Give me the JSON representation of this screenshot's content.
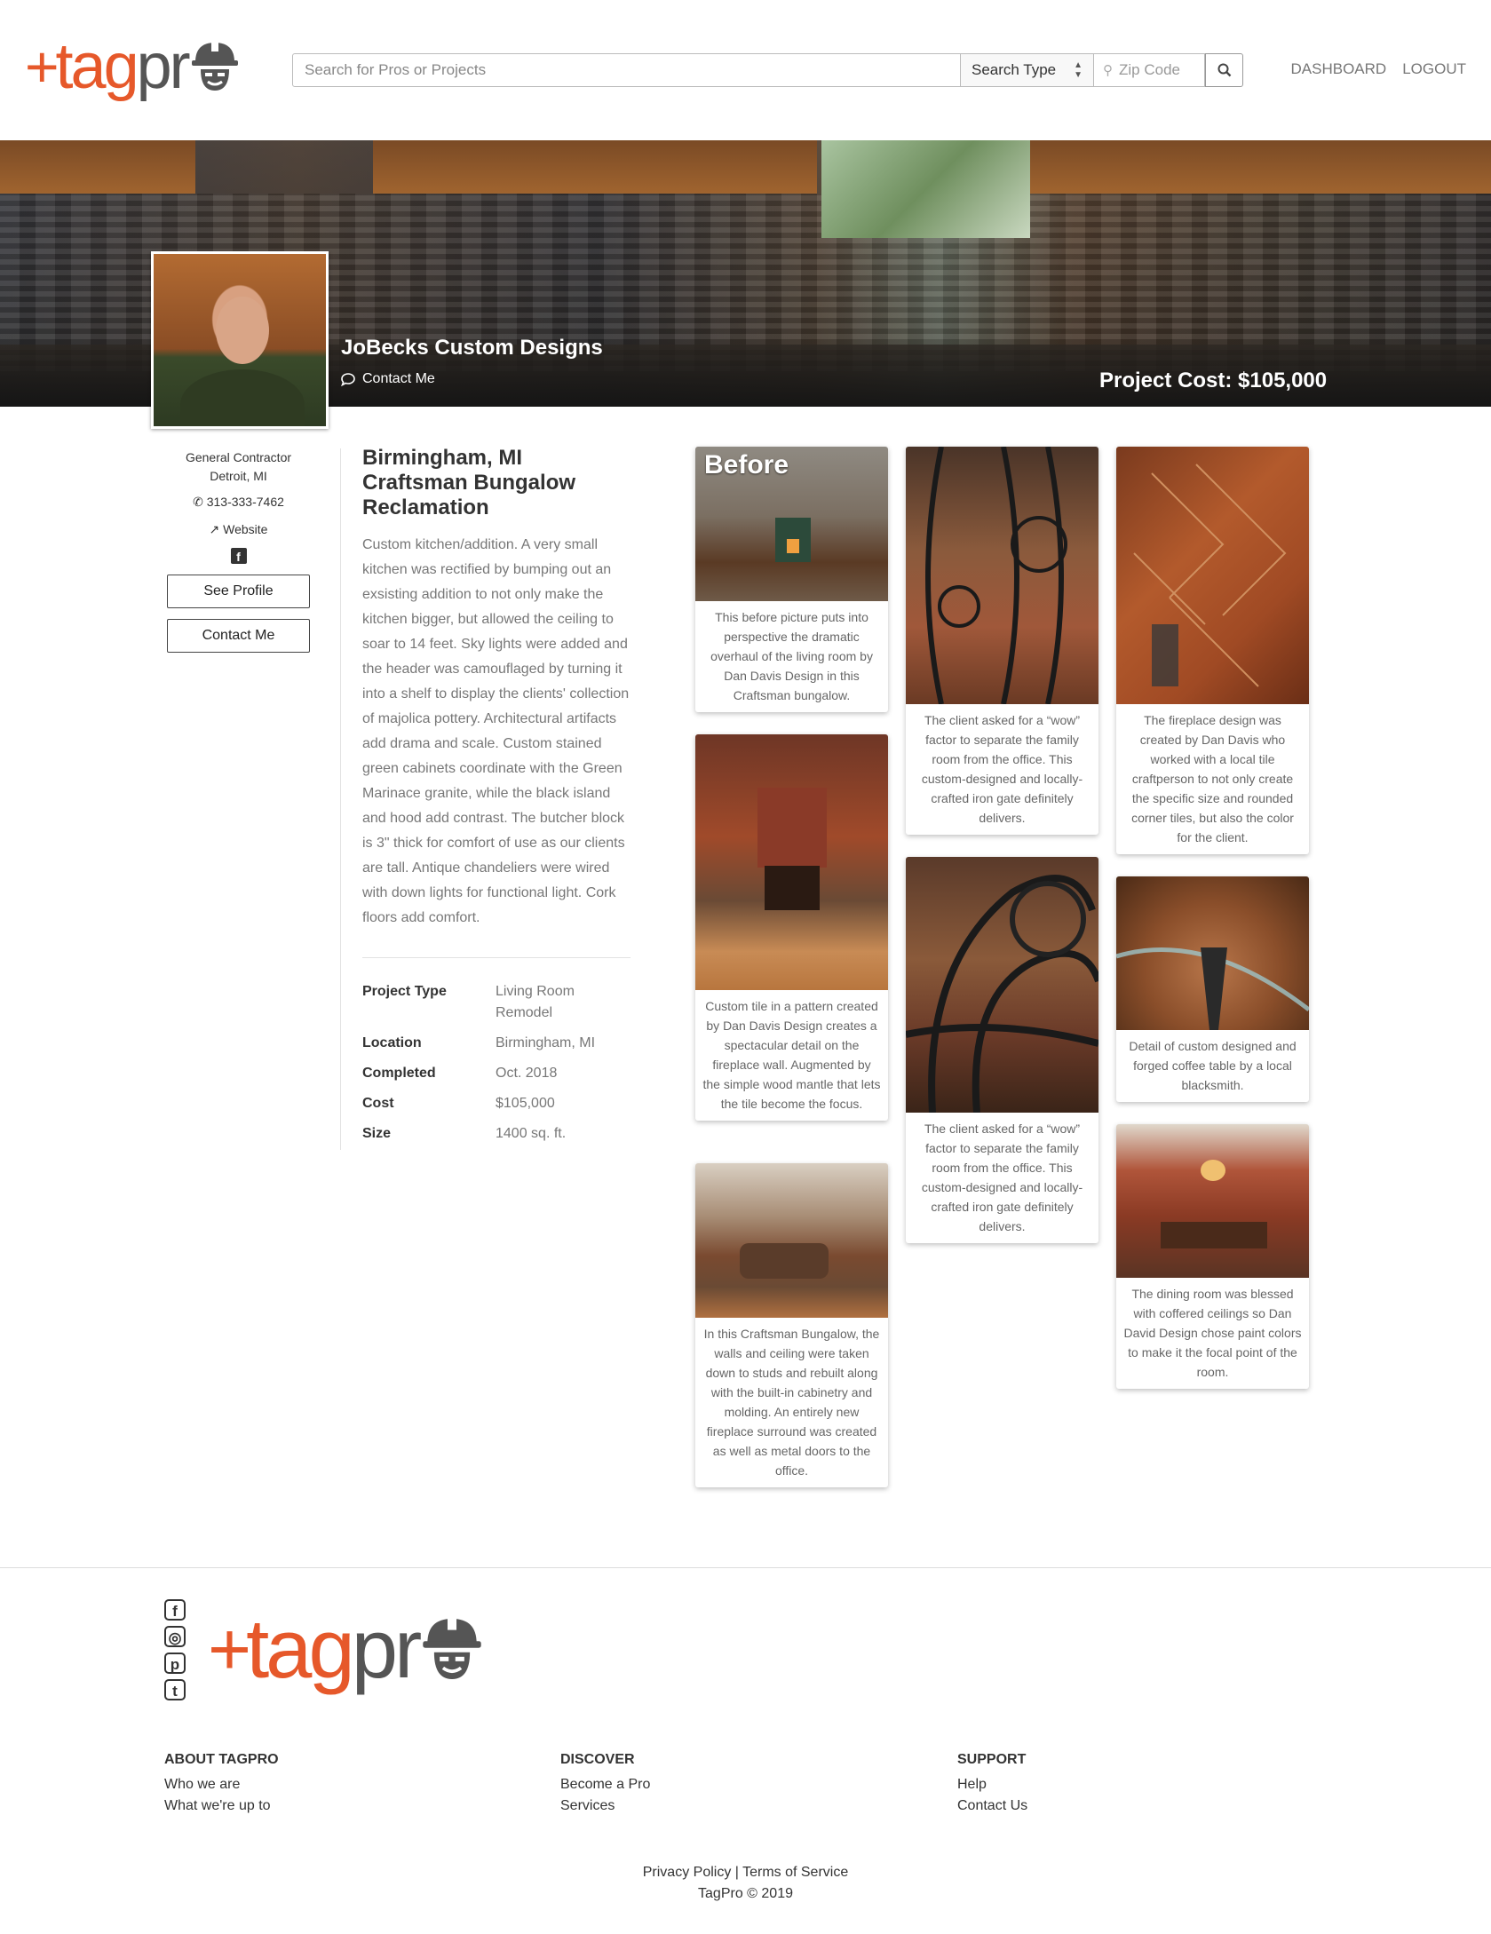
{
  "header": {
    "logo_plus": "+",
    "logo_tag": "tag",
    "logo_pr": "pr",
    "search_placeholder": "Search for Pros or Projects",
    "search_type": "Search Type",
    "zip_placeholder": "Zip Code",
    "nav": {
      "dashboard": "DASHBOARD",
      "logout": "LOGOUT"
    }
  },
  "hero": {
    "company": "JoBecks Custom Designs",
    "contact": "Contact Me",
    "project_cost": "Project Cost: $105,000"
  },
  "sidebar": {
    "role": "General Contractor",
    "location": "Detroit, MI",
    "phone": "313-333-7462",
    "website": "Website",
    "see_profile": "See Profile",
    "contact_me": "Contact Me"
  },
  "project": {
    "title": "Birmingham, MI Craftsman Bungalow Reclamation",
    "description": "Custom kitchen/addition. A very small kitchen was rectified by bumping out an exsisting addition to not only make the kitchen bigger, but allowed the ceiling to soar to 14 feet. Sky lights were added and the header was camouflaged by turning it into a shelf to display the clients' collection of majolica pottery. Architectural artifacts add drama and scale. Custom stained green cabinets coordinate with the Green Marinace granite, while the black island and hood add contrast. The butcher block is 3\" thick for comfort of use as our clients are tall. Antique chandeliers were wired with down lights for functional light. Cork floors add comfort.",
    "specs": [
      {
        "k": "Project Type",
        "v": "Living Room Remodel"
      },
      {
        "k": "Location",
        "v": "Birmingham, MI"
      },
      {
        "k": "Completed",
        "v": "Oct. 2018"
      },
      {
        "k": "Cost",
        "v": "$105,000"
      },
      {
        "k": "Size",
        "v": "1400 sq. ft."
      }
    ]
  },
  "gallery": {
    "before_label": "Before",
    "captions": [
      "This before picture puts into perspective the dramatic overhaul of the living room by Dan Davis Design in this Craftsman bungalow.",
      "Custom tile in a pattern created by Dan Davis Design creates a spectacular detail on the fireplace wall. Augmented by the simple wood mantle that lets the tile become the focus.",
      "In this Craftsman Bungalow, the walls and ceiling were taken down to studs and rebuilt along with the built-in cabinetry and molding. An entirely new fireplace surround was created as well as metal doors to the office.",
      "The client asked for a “wow” factor to separate the family room from the office. This custom-designed and locally-crafted iron gate definitely delivers.",
      "The client asked for a “wow” factor to separate the family room from the office. This custom-designed and locally-crafted iron gate definitely delivers.",
      "The fireplace design was created by Dan Davis who worked with a local tile craftperson to not only create the specific size and rounded corner tiles, but also the color for the client.",
      "Detail of custom designed and forged coffee table by a local blacksmith.",
      "The dining room was blessed with coffered ceilings so Dan David Design chose paint colors to make it the focal point of the room."
    ]
  },
  "footer": {
    "about": {
      "heading": "ABOUT TAGPRO",
      "links": [
        "Who we are",
        "What we're up to"
      ]
    },
    "discover": {
      "heading": "DISCOVER",
      "links": [
        "Become a Pro",
        "Services"
      ]
    },
    "support": {
      "heading": "SUPPORT",
      "links": [
        "Help",
        "Contact Us"
      ]
    },
    "legal": "Privacy Policy | Terms of Service",
    "copyright": "TagPro © 2019"
  },
  "colors": {
    "brand": "#e6582a",
    "text": "#333333",
    "muted": "#777777"
  },
  "icons": [
    "search-icon",
    "map-pin-icon",
    "chat-icon",
    "phone-icon",
    "external-link-icon",
    "facebook-icon",
    "instagram-icon",
    "pinterest-icon",
    "twitter-icon",
    "hard-hat-icon"
  ]
}
